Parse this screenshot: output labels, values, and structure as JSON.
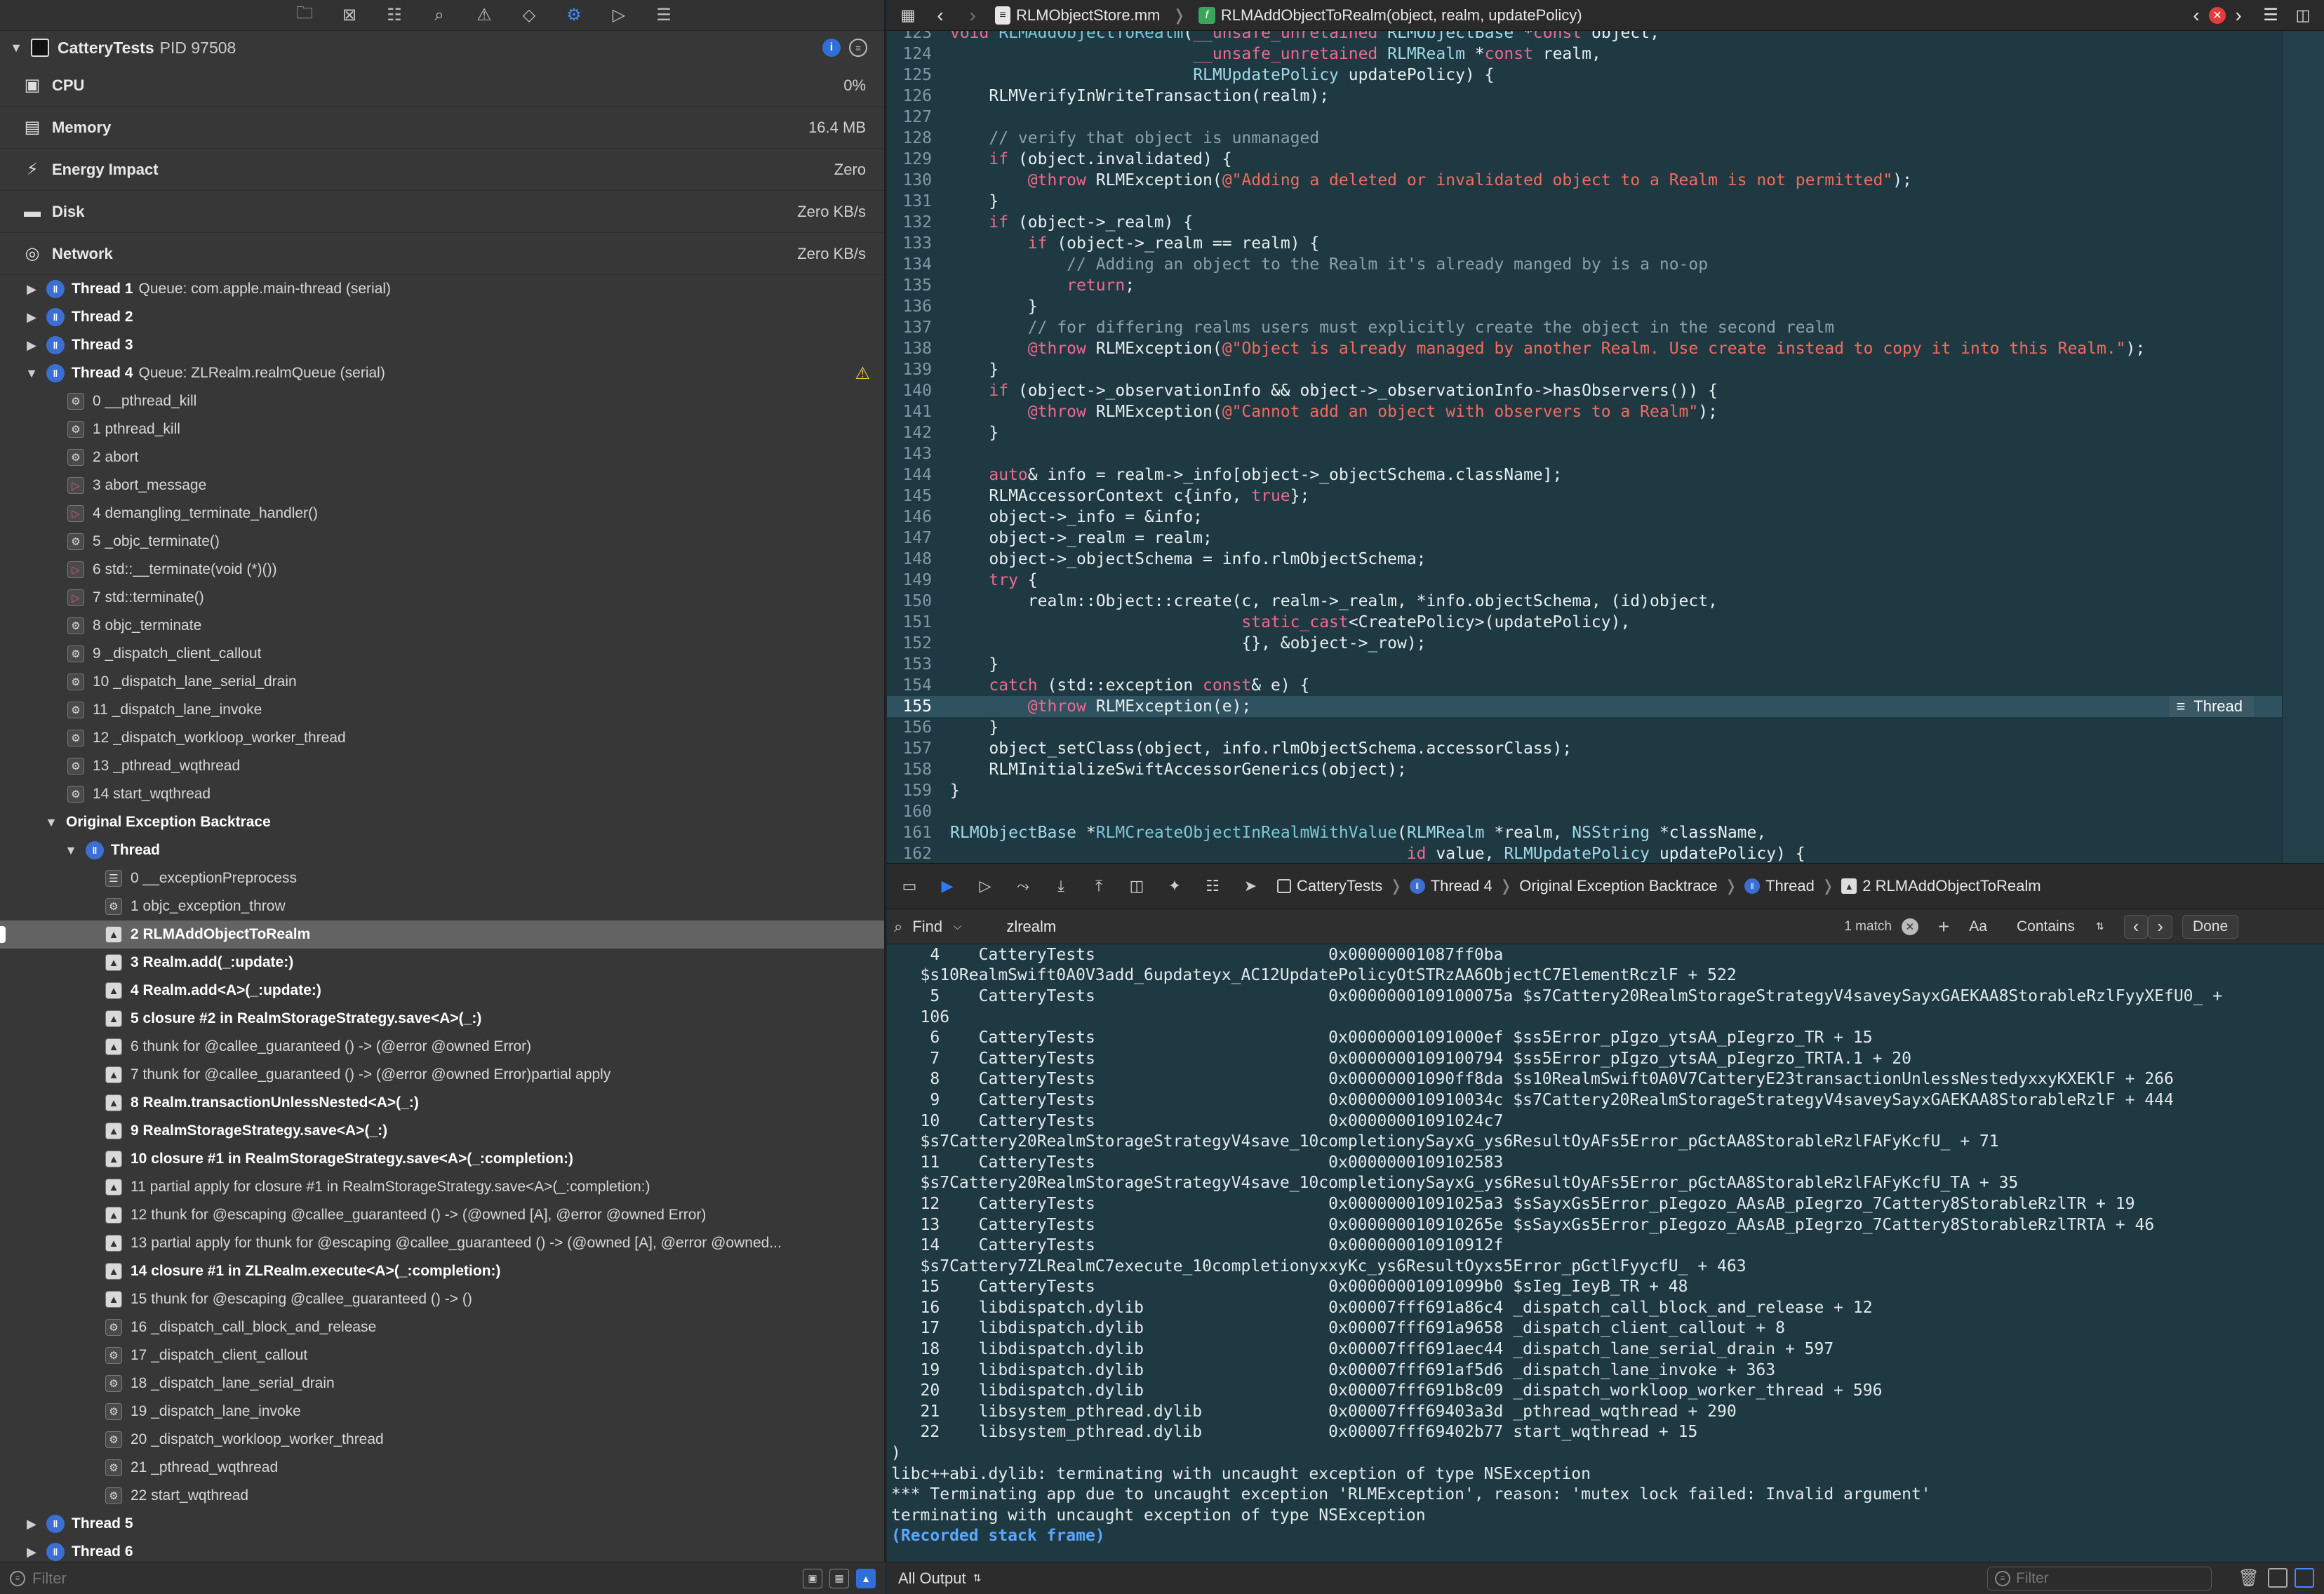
{
  "navigator": {
    "process": {
      "name": "CatteryTests",
      "pid": "PID 97508"
    },
    "gauges": [
      {
        "label": "CPU",
        "value": "0%",
        "icon": "cpu-icon"
      },
      {
        "label": "Memory",
        "value": "16.4 MB",
        "icon": "memory-icon"
      },
      {
        "label": "Energy Impact",
        "value": "Zero",
        "icon": "energy-icon"
      },
      {
        "label": "Disk",
        "value": "Zero KB/s",
        "icon": "disk-icon"
      },
      {
        "label": "Network",
        "value": "Zero KB/s",
        "icon": "network-icon"
      }
    ],
    "threads_top": [
      {
        "name": "Thread 1",
        "queue": "Queue: com.apple.main-thread (serial)"
      },
      {
        "name": "Thread 2",
        "queue": ""
      },
      {
        "name": "Thread 3",
        "queue": ""
      }
    ],
    "thread4": {
      "name": "Thread 4",
      "queue": "Queue: ZLRealm.realmQueue (serial)"
    },
    "thread4_frames": [
      {
        "label": "0 __pthread_kill",
        "kind": "sys"
      },
      {
        "label": "1 pthread_kill",
        "kind": "sys"
      },
      {
        "label": "2 abort",
        "kind": "sys"
      },
      {
        "label": "3 abort_message",
        "kind": "pink"
      },
      {
        "label": "4 demangling_terminate_handler()",
        "kind": "pink"
      },
      {
        "label": "5 _objc_terminate()",
        "kind": "sys"
      },
      {
        "label": "6 std::__terminate(void (*)())",
        "kind": "pink"
      },
      {
        "label": "7 std::terminate()",
        "kind": "pink"
      },
      {
        "label": "8 objc_terminate",
        "kind": "sys"
      },
      {
        "label": "9 _dispatch_client_callout",
        "kind": "sys"
      },
      {
        "label": "10 _dispatch_lane_serial_drain",
        "kind": "sys"
      },
      {
        "label": "11 _dispatch_lane_invoke",
        "kind": "sys"
      },
      {
        "label": "12 _dispatch_workloop_worker_thread",
        "kind": "sys"
      },
      {
        "label": "13 _pthread_wqthread",
        "kind": "sys"
      },
      {
        "label": "14 start_wqthread",
        "kind": "sys"
      }
    ],
    "backtrace_label": "Original Exception Backtrace",
    "backtrace_thread": "Thread",
    "backtrace_frames": [
      {
        "label": "0 __exceptionPreprocess",
        "kind": "list",
        "bold": false
      },
      {
        "label": "1 objc_exception_throw",
        "kind": "sys",
        "bold": false
      },
      {
        "label": "2 RLMAddObjectToRealm",
        "kind": "user",
        "bold": true
      },
      {
        "label": "3 Realm.add(_:update:)",
        "kind": "user",
        "bold": true
      },
      {
        "label": "4 Realm.add<A>(_:update:)",
        "kind": "user",
        "bold": true
      },
      {
        "label": "5 closure #2 in RealmStorageStrategy.save<A>(_:)",
        "kind": "user",
        "bold": true
      },
      {
        "label": "6 thunk for @callee_guaranteed () -> (@error @owned Error)",
        "kind": "user",
        "bold": false
      },
      {
        "label": "7 thunk for @callee_guaranteed () -> (@error @owned Error)partial apply",
        "kind": "user",
        "bold": false
      },
      {
        "label": "8 Realm.transactionUnlessNested<A>(_:)",
        "kind": "user",
        "bold": true
      },
      {
        "label": "9 RealmStorageStrategy.save<A>(_:)",
        "kind": "user",
        "bold": true
      },
      {
        "label": "10 closure #1 in RealmStorageStrategy.save<A>(_:completion:)",
        "kind": "user",
        "bold": true
      },
      {
        "label": "11 partial apply for closure #1 in RealmStorageStrategy.save<A>(_:completion:)",
        "kind": "user",
        "bold": false
      },
      {
        "label": "12 thunk for @escaping @callee_guaranteed () -> (@owned [A], @error @owned Error)",
        "kind": "user",
        "bold": false
      },
      {
        "label": "13 partial apply for thunk for @escaping @callee_guaranteed () -> (@owned [A], @error @owned...",
        "kind": "user",
        "bold": false
      },
      {
        "label": "14 closure #1 in ZLRealm.execute<A>(_:completion:)",
        "kind": "user",
        "bold": true
      },
      {
        "label": "15 thunk for @escaping @callee_guaranteed () -> ()",
        "kind": "user",
        "bold": false
      },
      {
        "label": "16 _dispatch_call_block_and_release",
        "kind": "sys",
        "bold": false
      },
      {
        "label": "17 _dispatch_client_callout",
        "kind": "sys",
        "bold": false
      },
      {
        "label": "18 _dispatch_lane_serial_drain",
        "kind": "sys",
        "bold": false
      },
      {
        "label": "19 _dispatch_lane_invoke",
        "kind": "sys",
        "bold": false
      },
      {
        "label": "20 _dispatch_workloop_worker_thread",
        "kind": "sys",
        "bold": false
      },
      {
        "label": "21 _pthread_wqthread",
        "kind": "sys",
        "bold": false
      },
      {
        "label": "22 start_wqthread",
        "kind": "sys",
        "bold": false
      }
    ],
    "threads_bottom": [
      "Thread 5",
      "Thread 6"
    ],
    "filter_placeholder": "Filter"
  },
  "editor": {
    "file": "RLMObjectStore.mm",
    "function": "RLMAddObjectToRealm(object, realm, updatePolicy)",
    "thread_badge": "Thread",
    "current_line": "155",
    "lines": [
      {
        "n": "123",
        "seg": [
          [
            "kw",
            "void "
          ],
          [
            "fn",
            "RLMAddObjectToRealm"
          ],
          [
            "ct",
            "("
          ],
          [
            "kw",
            "__unsafe_unretained "
          ],
          [
            "ty",
            "RLMObjectBase "
          ],
          [
            "ct",
            "*"
          ],
          [
            "kw",
            "const "
          ],
          [
            "ct",
            "object,"
          ]
        ]
      },
      {
        "n": "124",
        "seg": [
          [
            "ct",
            "                         "
          ],
          [
            "kw",
            "__unsafe_unretained "
          ],
          [
            "ty",
            "RLMRealm "
          ],
          [
            "ct",
            "*"
          ],
          [
            "kw",
            "const "
          ],
          [
            "ct",
            "realm,"
          ]
        ]
      },
      {
        "n": "125",
        "seg": [
          [
            "ct",
            "                         "
          ],
          [
            "ty",
            "RLMUpdatePolicy "
          ],
          [
            "ct",
            "updatePolicy) {"
          ]
        ]
      },
      {
        "n": "126",
        "seg": [
          [
            "ct",
            "    RLMVerifyInWriteTransaction(realm);"
          ]
        ]
      },
      {
        "n": "127",
        "seg": [
          [
            "ct",
            ""
          ]
        ]
      },
      {
        "n": "128",
        "seg": [
          [
            "cm",
            "    // verify that object is unmanaged"
          ]
        ]
      },
      {
        "n": "129",
        "seg": [
          [
            "kw",
            "    if "
          ],
          [
            "ct",
            "(object.invalidated) {"
          ]
        ]
      },
      {
        "n": "130",
        "seg": [
          [
            "at",
            "        @throw "
          ],
          [
            "ct",
            "RLMException("
          ],
          [
            "st",
            "@\"Adding a deleted or invalidated object to a Realm is not permitted\""
          ],
          [
            "ct",
            ");"
          ]
        ]
      },
      {
        "n": "131",
        "seg": [
          [
            "ct",
            "    }"
          ]
        ]
      },
      {
        "n": "132",
        "seg": [
          [
            "kw",
            "    if "
          ],
          [
            "ct",
            "(object->_realm) {"
          ]
        ]
      },
      {
        "n": "133",
        "seg": [
          [
            "kw",
            "        if "
          ],
          [
            "ct",
            "(object->_realm == realm) {"
          ]
        ]
      },
      {
        "n": "134",
        "seg": [
          [
            "cm",
            "            // Adding an object to the Realm it's already manged by is a no-op"
          ]
        ]
      },
      {
        "n": "135",
        "seg": [
          [
            "kw",
            "            return"
          ],
          [
            "ct",
            ";"
          ]
        ]
      },
      {
        "n": "136",
        "seg": [
          [
            "ct",
            "        }"
          ]
        ]
      },
      {
        "n": "137",
        "seg": [
          [
            "cm",
            "        // for differing realms users must explicitly create the object in the second realm"
          ]
        ]
      },
      {
        "n": "138",
        "seg": [
          [
            "at",
            "        @throw "
          ],
          [
            "ct",
            "RLMException("
          ],
          [
            "st",
            "@\"Object is already managed by another Realm. Use create instead to copy it into this Realm.\""
          ],
          [
            "ct",
            ");"
          ]
        ]
      },
      {
        "n": "139",
        "seg": [
          [
            "ct",
            "    }"
          ]
        ]
      },
      {
        "n": "140",
        "seg": [
          [
            "kw",
            "    if "
          ],
          [
            "ct",
            "(object->_observationInfo && object->_observationInfo->hasObservers()) {"
          ]
        ]
      },
      {
        "n": "141",
        "seg": [
          [
            "at",
            "        @throw "
          ],
          [
            "ct",
            "RLMException("
          ],
          [
            "st",
            "@\"Cannot add an object with observers to a Realm\""
          ],
          [
            "ct",
            ");"
          ]
        ]
      },
      {
        "n": "142",
        "seg": [
          [
            "ct",
            "    }"
          ]
        ]
      },
      {
        "n": "143",
        "seg": [
          [
            "ct",
            ""
          ]
        ]
      },
      {
        "n": "144",
        "seg": [
          [
            "kw",
            "    auto"
          ],
          [
            "ct",
            "& info = realm->_info[object->_objectSchema.className];"
          ]
        ]
      },
      {
        "n": "145",
        "seg": [
          [
            "ct",
            "    RLMAccessorContext c{info, "
          ],
          [
            "kw",
            "true"
          ],
          [
            "ct",
            "};"
          ]
        ]
      },
      {
        "n": "146",
        "seg": [
          [
            "ct",
            "    object->_info = &info;"
          ]
        ]
      },
      {
        "n": "147",
        "seg": [
          [
            "ct",
            "    object->_realm = realm;"
          ]
        ]
      },
      {
        "n": "148",
        "seg": [
          [
            "ct",
            "    object->_objectSchema = info.rlmObjectSchema;"
          ]
        ]
      },
      {
        "n": "149",
        "seg": [
          [
            "kw",
            "    try "
          ],
          [
            "ct",
            "{"
          ]
        ]
      },
      {
        "n": "150",
        "seg": [
          [
            "ct",
            "        realm::Object::create(c, realm->_realm, *info.objectSchema, (id)object,"
          ]
        ]
      },
      {
        "n": "151",
        "seg": [
          [
            "ct",
            "                              "
          ],
          [
            "kw",
            "static_cast"
          ],
          [
            "ct",
            "<CreatePolicy>(updatePolicy),"
          ]
        ]
      },
      {
        "n": "152",
        "seg": [
          [
            "ct",
            "                              {}, &object->_row);"
          ]
        ]
      },
      {
        "n": "153",
        "seg": [
          [
            "ct",
            "    }"
          ]
        ]
      },
      {
        "n": "154",
        "seg": [
          [
            "kw",
            "    catch "
          ],
          [
            "ct",
            "(std::exception "
          ],
          [
            "kw",
            "const"
          ],
          [
            "ct",
            "& e) {"
          ]
        ]
      },
      {
        "n": "155",
        "seg": [
          [
            "at",
            "        @throw "
          ],
          [
            "ct",
            "RLMException(e);"
          ]
        ]
      },
      {
        "n": "156",
        "seg": [
          [
            "ct",
            "    }"
          ]
        ]
      },
      {
        "n": "157",
        "seg": [
          [
            "ct",
            "    object_setClass(object, info.rlmObjectSchema.accessorClass);"
          ]
        ]
      },
      {
        "n": "158",
        "seg": [
          [
            "ct",
            "    RLMInitializeSwiftAccessorGenerics(object);"
          ]
        ]
      },
      {
        "n": "159",
        "seg": [
          [
            "ct",
            "}"
          ]
        ]
      },
      {
        "n": "160",
        "seg": [
          [
            "ct",
            ""
          ]
        ]
      },
      {
        "n": "161",
        "seg": [
          [
            "ty",
            "RLMObjectBase "
          ],
          [
            "ct",
            "*"
          ],
          [
            "fn",
            "RLMCreateObjectInRealmWithValue"
          ],
          [
            "ct",
            "("
          ],
          [
            "ty",
            "RLMRealm "
          ],
          [
            "ct",
            "*realm, "
          ],
          [
            "ty",
            "NSString "
          ],
          [
            "ct",
            "*className,"
          ]
        ]
      },
      {
        "n": "162",
        "seg": [
          [
            "ct",
            "                                               "
          ],
          [
            "kw",
            "id "
          ],
          [
            "ct",
            "value, "
          ],
          [
            "ty",
            "RLMUpdatePolicy "
          ],
          [
            "ct",
            "updatePolicy) {"
          ]
        ]
      }
    ]
  },
  "debug_bar": {
    "breadcrumbs": [
      "CatteryTests",
      "Thread 4",
      "Original Exception Backtrace",
      "Thread",
      "2 RLMAddObjectToRealm"
    ]
  },
  "find": {
    "mode": "Find",
    "query": "zlrealm",
    "matches": "1 match",
    "case_label": "Aa",
    "match_type": "Contains",
    "done_label": "Done"
  },
  "console": {
    "lines": [
      "    4    CatteryTests                        0x00000001087ff0ba",
      "   $s10RealmSwift0A0V3add_6updateyx_AC12UpdatePolicyOtSTRzAA6ObjectC7ElementRczlF + 522",
      "    5    CatteryTests                        0x0000000109100075a $s7Cattery20RealmStorageStrategyV4saveySayxGAEKAA8StorableRzlFyyXEfU0_ +",
      "   106",
      "    6    CatteryTests                        0x00000001091000ef $ss5Error_pIgzo_ytsAA_pIegrzo_TR + 15",
      "    7    CatteryTests                        0x0000000109100794 $ss5Error_pIgzo_ytsAA_pIegrzo_TRTA.1 + 20",
      "    8    CatteryTests                        0x00000001090ff8da $s10RealmSwift0A0V7CatteryE23transactionUnlessNestedyxxyKXEKlF + 266",
      "    9    CatteryTests                        0x000000010910034c $s7Cattery20RealmStorageStrategyV4saveySayxGAEKAA8StorableRzlF + 444",
      "   10    CatteryTests                        0x00000001091024c7",
      "   $s7Cattery20RealmStorageStrategyV4save_10completionySayxG_ys6ResultOyAFs5Error_pGctAA8StorableRzlFAFyKcfU_ + 71",
      "   11    CatteryTests                        0x0000000109102583",
      "   $s7Cattery20RealmStorageStrategyV4save_10completionySayxG_ys6ResultOyAFs5Error_pGctAA8StorableRzlFAFyKcfU_TA + 35",
      "   12    CatteryTests                        0x00000001091025a3 $sSayxGs5Error_pIegozo_AAsAB_pIegrzo_7Cattery8StorableRzlTR + 19",
      "   13    CatteryTests                        0x000000010910265e $sSayxGs5Error_pIegozo_AAsAB_pIegrzo_7Cattery8StorableRzlTRTA + 46",
      "   14    CatteryTests                        0x000000010910912f",
      "   $s7Cattery7ZLRealmC7execute_10completionyxxyKc_ys6ResultOyxs5Error_pGctlFyycfU_ + 463",
      "   15    CatteryTests                        0x00000001091099b0 $sIeg_IeyB_TR + 48",
      "   16    libdispatch.dylib                   0x00007fff691a86c4 _dispatch_call_block_and_release + 12",
      "   17    libdispatch.dylib                   0x00007fff691a9658 _dispatch_client_callout + 8",
      "   18    libdispatch.dylib                   0x00007fff691aec44 _dispatch_lane_serial_drain + 597",
      "   19    libdispatch.dylib                   0x00007fff691af5d6 _dispatch_lane_invoke + 363",
      "   20    libdispatch.dylib                   0x00007fff691b8c09 _dispatch_workloop_worker_thread + 596",
      "   21    libsystem_pthread.dylib             0x00007fff69403a3d _pthread_wqthread + 290",
      "   22    libsystem_pthread.dylib             0x00007fff69402b77 start_wqthread + 15",
      ")",
      "libc++abi.dylib: terminating with uncaught exception of type NSException",
      "*** Terminating app due to uncaught exception 'RLMException', reason: 'mutex lock failed: Invalid argument'",
      "terminating with uncaught exception of type NSException"
    ],
    "recorded": "(Recorded stack frame)",
    "output_selector": "All Output",
    "filter_placeholder": "Filter"
  }
}
